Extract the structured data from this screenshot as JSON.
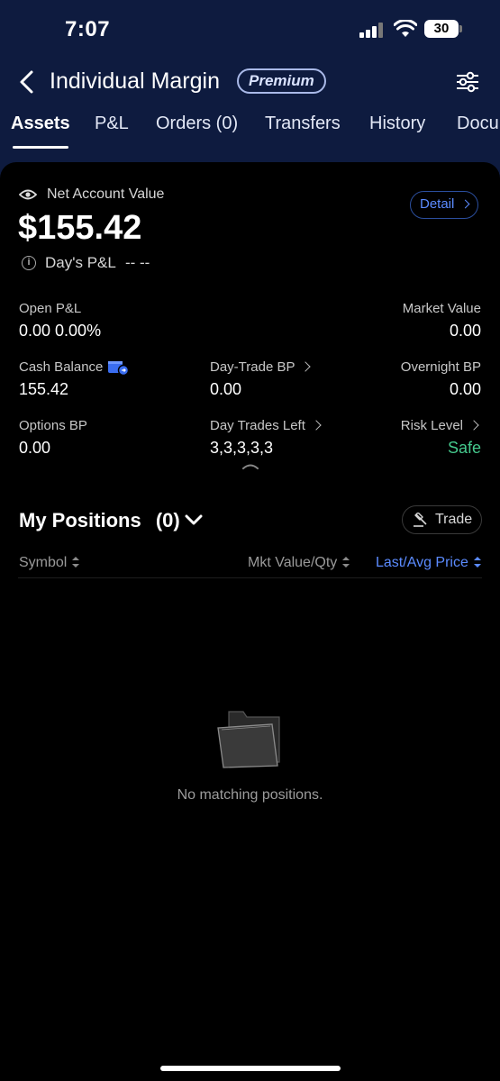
{
  "status_bar": {
    "time": "7:07",
    "battery": "30"
  },
  "header": {
    "title": "Individual Margin",
    "badge": "Premium"
  },
  "tabs": [
    {
      "label": "Assets",
      "active": true
    },
    {
      "label": "P&L"
    },
    {
      "label": "Orders (0)"
    },
    {
      "label": "Transfers"
    },
    {
      "label": "History"
    },
    {
      "label": "Docu"
    }
  ],
  "account": {
    "net_value_label": "Net Account Value",
    "net_value": "$155.42",
    "day_pl_label": "Day's P&L",
    "day_pl_value": "-- --",
    "detail_label": "Detail"
  },
  "metrics": {
    "open_pl": {
      "label": "Open P&L",
      "value": "0.00 0.00%"
    },
    "market_value": {
      "label": "Market Value",
      "value": "0.00"
    },
    "cash_balance": {
      "label": "Cash Balance",
      "value": "155.42"
    },
    "day_trade_bp": {
      "label": "Day-Trade BP",
      "value": "0.00"
    },
    "overnight_bp": {
      "label": "Overnight BP",
      "value": "0.00"
    },
    "options_bp": {
      "label": "Options BP",
      "value": "0.00"
    },
    "day_trades_left": {
      "label": "Day Trades Left",
      "value": "3,3,3,3,3"
    },
    "risk_level": {
      "label": "Risk Level",
      "value": "Safe"
    }
  },
  "positions": {
    "title": "My Positions",
    "count": "(0)",
    "trade_label": "Trade",
    "columns": [
      "Symbol",
      "Mkt Value/Qty",
      "Last/Avg Price"
    ],
    "empty_text": "No matching positions."
  },
  "colors": {
    "header_bg": "#0e1b3f",
    "accent_blue": "#5b8bff",
    "safe_green": "#45c98d"
  }
}
